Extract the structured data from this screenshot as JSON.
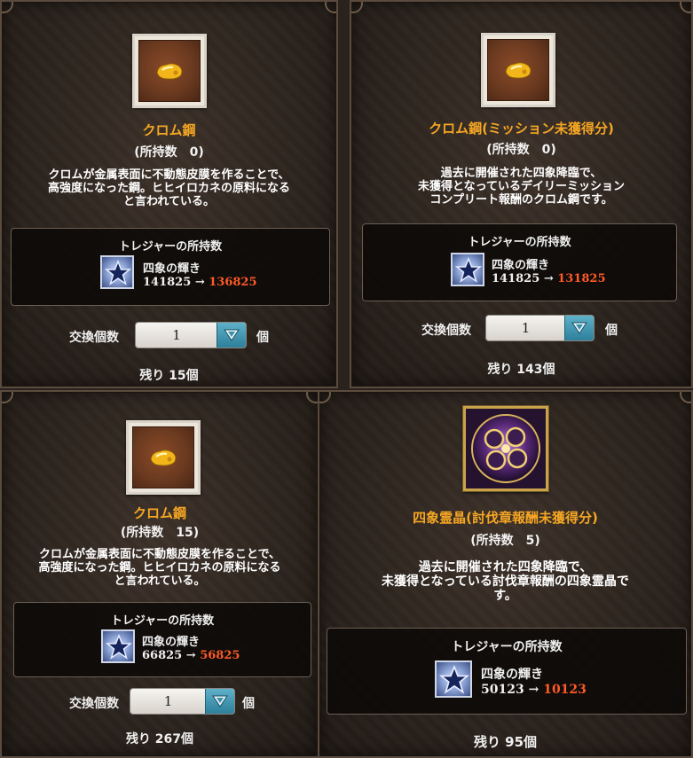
{
  "panels": [
    {
      "name": "クロム鋼",
      "owned": "(所持数　0)",
      "desc": [
        "クロムが金属表面に不動態皮膜を作ることで、",
        "高強度になった鋼。ヒヒイロカネの原料になる",
        "と言われている。"
      ],
      "treasure_title": "トレジャーの所持数",
      "treasure_name": "四象の輝き",
      "count_before": "141825",
      "arrow": "→",
      "count_after": "136825",
      "qty_label": "交換個数",
      "qty_value": "1",
      "qty_unit": "個",
      "remaining": "残り 15個"
    },
    {
      "name": "クロム鋼(ミッション未獲得分)",
      "owned": "(所持数　0)",
      "desc": [
        "過去に開催された四象降臨で、",
        "未獲得となっているデイリーミッション",
        "コンプリート報酬のクロム鋼です。"
      ],
      "treasure_title": "トレジャーの所持数",
      "treasure_name": "四象の輝き",
      "count_before": "141825",
      "arrow": "→",
      "count_after": "131825",
      "qty_label": "交換個数",
      "qty_value": "1",
      "qty_unit": "個",
      "remaining": "残り 143個"
    },
    {
      "name": "クロム鋼",
      "owned": "(所持数　15)",
      "desc": [
        "クロムが金属表面に不動態皮膜を作ることで、",
        "高強度になった鋼。ヒヒイロカネの原料になる",
        "と言われている。"
      ],
      "treasure_title": "トレジャーの所持数",
      "treasure_name": "四象の輝き",
      "count_before": "66825",
      "arrow": "→",
      "count_after": "56825",
      "qty_label": "交換個数",
      "qty_value": "1",
      "qty_unit": "個",
      "remaining": "残り 267個"
    },
    {
      "name": "四象霊晶(討伐章報酬未獲得分)",
      "owned": "(所持数　5)",
      "desc": [
        "過去に開催された四象降臨で、",
        "未獲得となっている討伐章報酬の四象霊晶で",
        "す。"
      ],
      "treasure_title": "トレジャーの所持数",
      "treasure_name": "四象の輝き",
      "count_before": "50123",
      "arrow": "→",
      "count_after": "10123",
      "remaining": "残り 95個"
    }
  ],
  "colors": {
    "item_name": "#f5a623",
    "count_after": "#ff5a26",
    "select_button": "#2d7f9a"
  },
  "icons": {
    "item": "chromium-steel-nugget-icon",
    "crystal": "four-symbols-crystal-icon",
    "treasure": "four-symbols-radiance-star-icon",
    "dropdown": "chevron-down-icon"
  }
}
